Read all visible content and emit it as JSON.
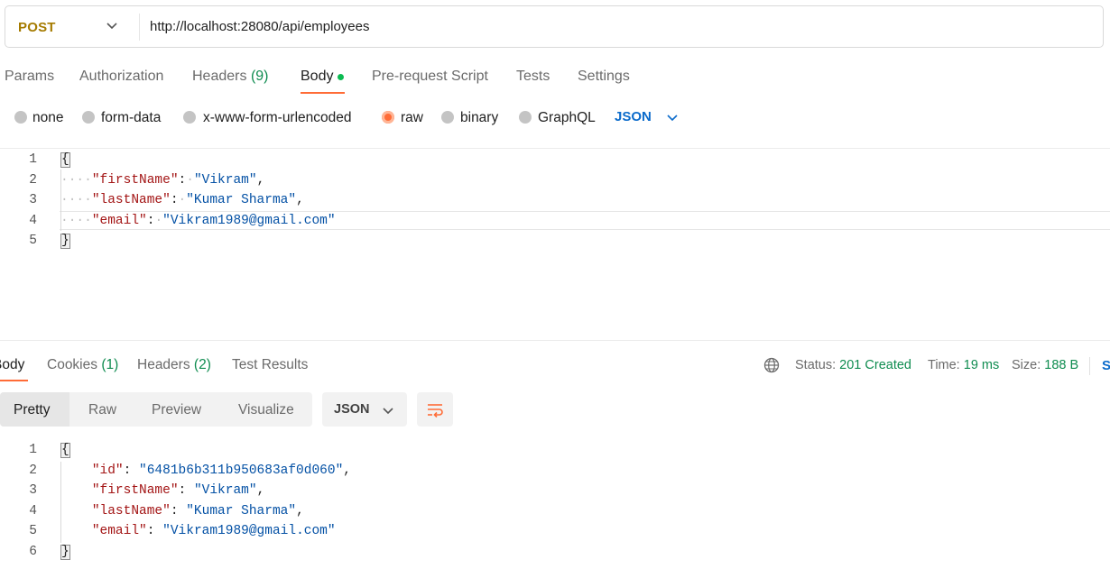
{
  "request": {
    "method": "POST",
    "url": "http://localhost:28080/api/employees"
  },
  "request_tabs": [
    {
      "label": "Params"
    },
    {
      "label": "Authorization"
    },
    {
      "label": "Headers",
      "count": "(9)"
    },
    {
      "label": "Body"
    },
    {
      "label": "Pre-request Script"
    },
    {
      "label": "Tests"
    },
    {
      "label": "Settings"
    }
  ],
  "body_modes": [
    "none",
    "form-data",
    "x-www-form-urlencoded",
    "raw",
    "binary",
    "GraphQL"
  ],
  "body_mode_selected": "raw",
  "body_format": "JSON",
  "request_body_lines": {
    "l1": "{",
    "k2": "\"firstName\"",
    "v2": "\"Vikram\"",
    "k3": "\"lastName\"",
    "v3": "\"Kumar Sharma\"",
    "k4": "\"email\"",
    "v4": "\"Vikram1989@gmail.com\"",
    "l5": "}"
  },
  "line_numbers_req": [
    "1",
    "2",
    "3",
    "4",
    "5"
  ],
  "response_tabs": [
    {
      "label": "Body"
    },
    {
      "label": "Cookies",
      "count": "(1)"
    },
    {
      "label": "Headers",
      "count": "(2)"
    },
    {
      "label": "Test Results"
    }
  ],
  "response_status": {
    "status_label": "Status:",
    "status_value": "201 Created",
    "time_label": "Time:",
    "time_value": "19 ms",
    "size_label": "Size:",
    "size_value": "188 B",
    "save_partial": "S"
  },
  "view_modes": [
    "Pretty",
    "Raw",
    "Preview",
    "Visualize"
  ],
  "response_format": "JSON",
  "response_body_lines": {
    "l1": "{",
    "k2": "\"id\"",
    "v2": "\"6481b6b311b950683af0d060\"",
    "k3": "\"firstName\"",
    "v3": "\"Vikram\"",
    "k4": "\"lastName\"",
    "v4": "\"Kumar Sharma\"",
    "k5": "\"email\"",
    "v5": "\"Vikram1989@gmail.com\"",
    "l6": "}"
  },
  "line_numbers_res": [
    "1",
    "2",
    "3",
    "4",
    "5",
    "6"
  ],
  "colors": {
    "accent": "#ff6c37",
    "success": "#0f8c50",
    "link": "#0b6bcb",
    "method": "#a57b00"
  }
}
